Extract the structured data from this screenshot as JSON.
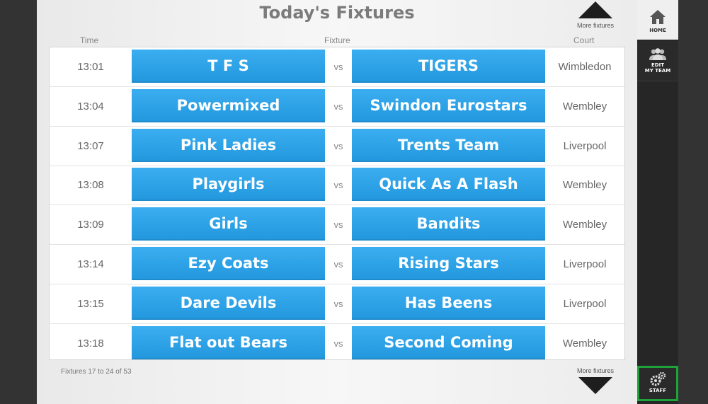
{
  "page_title": "Today's Fixtures",
  "columns": {
    "time": "Time",
    "fixture": "Fixture",
    "court": "Court"
  },
  "more_fixtures_top": "More fixtures",
  "more_fixtures_bottom": "More fixtures",
  "fixtures": [
    {
      "time": "13:01",
      "home": "T F S",
      "vs": "vs",
      "away": "TIGERS",
      "court": "Wimbledon"
    },
    {
      "time": "13:04",
      "home": "Powermixed",
      "vs": "vs",
      "away": "Swindon Eurostars",
      "court": "Wembley"
    },
    {
      "time": "13:07",
      "home": "Pink Ladies",
      "vs": "vs",
      "away": "Trents Team",
      "court": "Liverpool"
    },
    {
      "time": "13:08",
      "home": "Playgirls",
      "vs": "vs",
      "away": "Quick As A Flash",
      "court": "Wembley"
    },
    {
      "time": "13:09",
      "home": "Girls",
      "vs": "vs",
      "away": "Bandits",
      "court": "Wembley"
    },
    {
      "time": "13:14",
      "home": "Ezy Coats",
      "vs": "vs",
      "away": "Rising Stars",
      "court": "Liverpool"
    },
    {
      "time": "13:15",
      "home": "Dare Devils",
      "vs": "vs",
      "away": "Has Beens",
      "court": "Liverpool"
    },
    {
      "time": "13:18",
      "home": "Flat out Bears",
      "vs": "vs",
      "away": "Second Coming",
      "court": "Wembley"
    }
  ],
  "pager_text": "Fixtures 17 to 24 of 53",
  "sidebar": {
    "home_label": "HOME",
    "edit_label_line1": "EDIT",
    "edit_label_line2": "MY TEAM",
    "staff_label": "STAFF"
  },
  "colors": {
    "team_button": "#2aa3e8",
    "staff_highlight": "#1ea33b",
    "sidebar_bg": "#262626"
  },
  "icons": {
    "home": "home-icon",
    "edit_team": "people-icon",
    "staff": "gears-icon",
    "more_up": "triangle-up-icon",
    "more_down": "triangle-down-icon"
  }
}
